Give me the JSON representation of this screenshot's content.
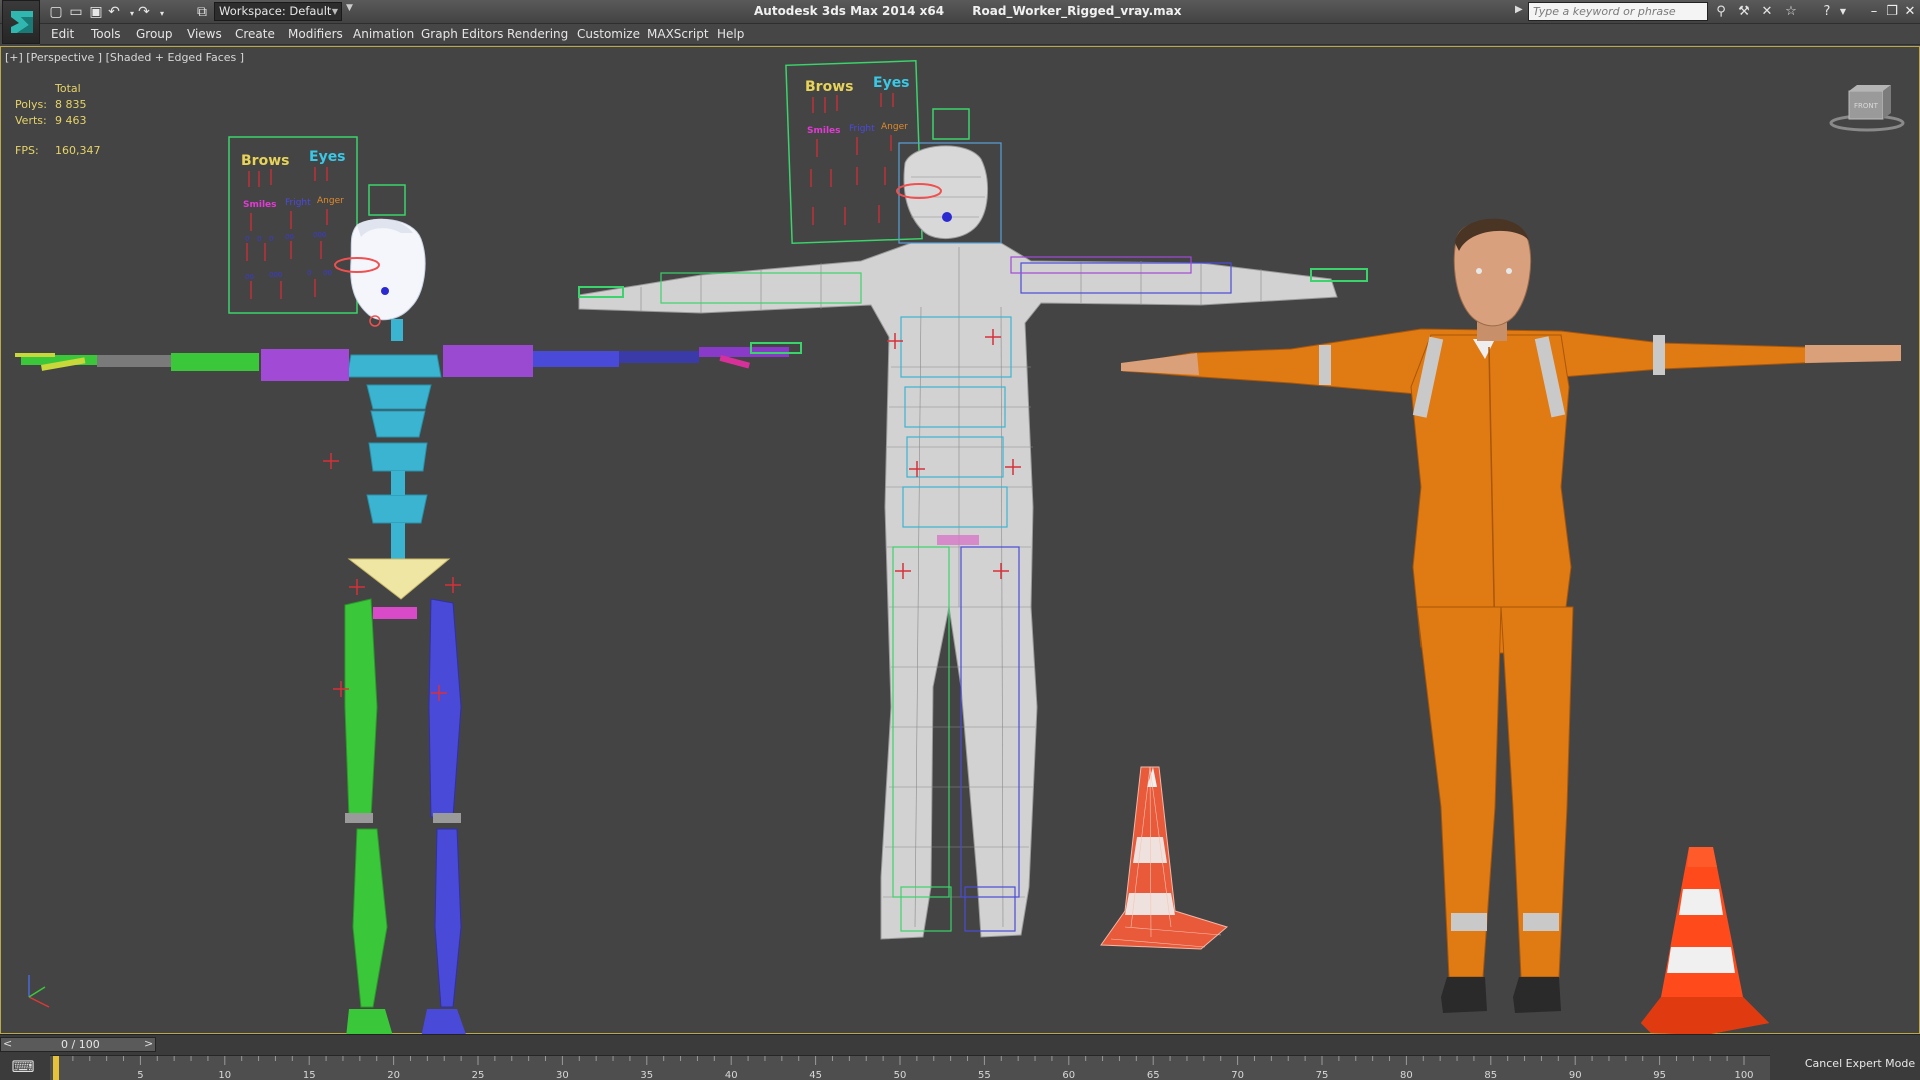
{
  "titlebar": {
    "workspace": "Workspace: Default",
    "app_name": "Autodesk 3ds Max  2014 x64",
    "file_name": "Road_Worker_Rigged_vray.max",
    "search_placeholder": "Type a keyword or phrase"
  },
  "menu": [
    "Edit",
    "Tools",
    "Group",
    "Views",
    "Create",
    "Modifiers",
    "Animation",
    "Graph Editors",
    "Rendering",
    "Customize",
    "MAXScript",
    "Help"
  ],
  "viewport": {
    "label": "[+] [Perspective ] [Shaded + Edged Faces ]",
    "stats": {
      "header": "Total",
      "polys_label": "Polys:",
      "polys_value": "8 835",
      "verts_label": "Verts:",
      "verts_value": "9 463",
      "fps_label": "FPS:",
      "fps_value": "160,347"
    },
    "face_panel": {
      "brows": "Brows",
      "eyes": "Eyes",
      "smiles": "Smiles",
      "fright": "Fright",
      "anger": "Anger"
    },
    "viewcube_label": "FRONT"
  },
  "timeline": {
    "frame": "0 / 100",
    "prev_label": "<",
    "next_label": ">",
    "ticks": [
      "5",
      "10",
      "15",
      "20",
      "25",
      "30",
      "35",
      "40",
      "45",
      "50",
      "55",
      "60",
      "65",
      "70",
      "75",
      "80",
      "85",
      "90",
      "95",
      "100"
    ],
    "cancel_expert": "Cancel Expert Mode"
  },
  "colors": {
    "viewport_bg": "#444444",
    "stat_text": "#e6d36a",
    "uniform_orange": "#e07a12",
    "reflective_stripe": "#c9c9c9",
    "cone_orange": "#ff4a1c"
  }
}
